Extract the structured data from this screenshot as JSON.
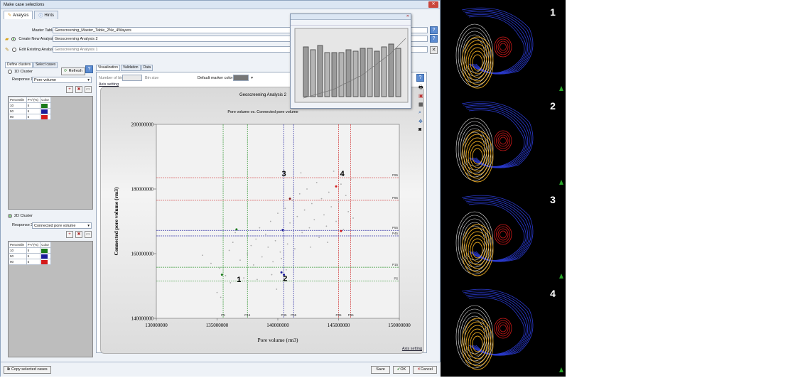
{
  "window": {
    "title": "Make case selections",
    "tabs": [
      {
        "label": "Analysis"
      },
      {
        "label": "Hints"
      }
    ]
  },
  "form": {
    "master_table_label": "Master Table:",
    "master_table_value": "Geoscreening_Master_Table_2Nx_4Wayers",
    "create_new_label": "Create New Analysis:",
    "create_new_value": "Geoscreening Analysis 2",
    "edit_existing_label": "Edit Existing Analysis:",
    "edit_existing_value": "Geoscreening Analysis 1"
  },
  "left_panel": {
    "tabs": [
      "Define clusters",
      "Select cases"
    ],
    "oned_label": "1D Cluster",
    "refresh_label": "Refresh",
    "response1_label": "Response 1:",
    "response1_value": "Pore volume",
    "twod_label": "2D Cluster",
    "response2_label": "Response 2:",
    "response2_value": "Connected pore volume",
    "table_headers": [
      "Percentile",
      "P+/-(%)",
      "Color"
    ],
    "rows1": [
      {
        "p": "10",
        "pm": "5",
        "color": "#1a7a1a"
      },
      {
        "p": "50",
        "pm": "5",
        "color": "#1a1a9a"
      },
      {
        "p": "90",
        "pm": "5",
        "color": "#d41a1a"
      }
    ],
    "rows2": [
      {
        "p": "10",
        "pm": "5",
        "color": "#1a7a1a"
      },
      {
        "p": "50",
        "pm": "5",
        "color": "#1a1a9a"
      },
      {
        "p": "90",
        "pm": "5",
        "color": "#d41a1a"
      }
    ]
  },
  "main_panel": {
    "tabs": [
      "Visualization",
      "Validation",
      "Data"
    ],
    "num_bins_label": "Number of bins",
    "bin_size_label": "Bin size",
    "marker_color_label": "Default marker color:",
    "axis_setting_top": "Axis setting",
    "axis_setting_bottom": "Axis setting"
  },
  "chart_data": {
    "type": "scatter",
    "title": "Geoscreening Analysis 2",
    "subtitle": "Pore volume vs. Connected pore volume",
    "xlabel": "Pore volume (rm3)",
    "ylabel": "Connected pore volume (rm3)",
    "xlim": [
      130000000,
      150000000
    ],
    "ylim": [
      140000000,
      200000000
    ],
    "xticks": [
      "130000000",
      "135000000",
      "140000000",
      "145000000",
      "150000000"
    ],
    "yticks": [
      "140000000",
      "160000000",
      "180000000",
      "200000000"
    ],
    "vlines": [
      {
        "x": 135500000,
        "label": "P5",
        "color": "#3a9a3a"
      },
      {
        "x": 137500000,
        "label": "P15",
        "color": "#3a9a3a"
      },
      {
        "x": 140500000,
        "label": "P45",
        "color": "#3a3aaa"
      },
      {
        "x": 141300000,
        "label": "P55",
        "color": "#3a3aaa"
      },
      {
        "x": 145000000,
        "label": "P85",
        "color": "#d43a3a"
      },
      {
        "x": 146000000,
        "label": "P95",
        "color": "#d43a3a"
      }
    ],
    "hlines": [
      {
        "y": 151500000,
        "label": "P5",
        "color": "#3a9a3a"
      },
      {
        "y": 155800000,
        "label": "P15",
        "color": "#3a9a3a"
      },
      {
        "y": 165500000,
        "label": "P45",
        "color": "#3a3aaa"
      },
      {
        "y": 167200000,
        "label": "P55",
        "color": "#3a3aaa"
      },
      {
        "y": 176500000,
        "label": "P85",
        "color": "#d43a3a"
      },
      {
        "y": 183500000,
        "label": "P95",
        "color": "#d43a3a"
      }
    ],
    "points": [
      [
        133800000,
        159500000
      ],
      [
        134500000,
        157000000
      ],
      [
        135000000,
        148000000
      ],
      [
        135200000,
        155500000
      ],
      [
        135700000,
        153200000
      ],
      [
        136000000,
        161000000
      ],
      [
        136300000,
        163500000
      ],
      [
        136500000,
        166500000
      ],
      [
        136900000,
        158000000
      ],
      [
        137200000,
        152500000
      ],
      [
        137500000,
        160000000
      ],
      [
        137800000,
        162500000
      ],
      [
        138000000,
        156500000
      ],
      [
        138200000,
        164500000
      ],
      [
        138500000,
        168000000
      ],
      [
        138700000,
        159000000
      ],
      [
        139000000,
        166000000
      ],
      [
        139200000,
        162000000
      ],
      [
        139400000,
        170000000
      ],
      [
        139600000,
        157500000
      ],
      [
        139800000,
        164000000
      ],
      [
        140000000,
        172500000
      ],
      [
        140200000,
        160500000
      ],
      [
        140400000,
        167000000
      ],
      [
        140600000,
        174000000
      ],
      [
        140800000,
        163000000
      ],
      [
        141000000,
        169500000
      ],
      [
        141200000,
        176500000
      ],
      [
        141400000,
        161500000
      ],
      [
        141600000,
        171500000
      ],
      [
        141800000,
        178500000
      ],
      [
        142000000,
        166500000
      ],
      [
        142200000,
        173500000
      ],
      [
        142400000,
        180000000
      ],
      [
        142600000,
        168000000
      ],
      [
        142800000,
        175500000
      ],
      [
        143000000,
        170500000
      ],
      [
        143200000,
        182000000
      ],
      [
        143400000,
        165000000
      ],
      [
        143600000,
        177000000
      ],
      [
        143800000,
        172000000
      ],
      [
        144000000,
        168500000
      ],
      [
        144200000,
        179000000
      ],
      [
        144400000,
        174500000
      ],
      [
        144600000,
        185500000
      ],
      [
        144800000,
        170000000
      ],
      [
        145000000,
        176000000
      ],
      [
        145200000,
        181500000
      ],
      [
        145400000,
        167500000
      ],
      [
        145600000,
        178000000
      ],
      [
        145800000,
        173000000
      ],
      [
        146000000,
        183000000
      ],
      [
        146200000,
        171000000
      ],
      [
        135300000,
        146500000
      ],
      [
        136100000,
        151000000
      ],
      [
        138300000,
        152000000
      ],
      [
        139500000,
        153500000
      ],
      [
        140700000,
        155000000
      ],
      [
        140300000,
        158500000
      ],
      [
        137000000,
        165500000
      ],
      [
        142700000,
        162000000
      ],
      [
        144100000,
        163500000
      ],
      [
        141900000,
        185000000
      ],
      [
        139900000,
        149000000
      ]
    ],
    "highlight_points": [
      {
        "x": 135400000,
        "y": 153500000,
        "color": "#1a7a1a"
      },
      {
        "x": 136600000,
        "y": 167500000,
        "color": "#1a7a1a"
      },
      {
        "x": 140300000,
        "y": 154200000,
        "color": "#1a1a9a"
      },
      {
        "x": 140500000,
        "y": 153500000,
        "color": "#1a1a9a"
      },
      {
        "x": 140400000,
        "y": 167300000,
        "color": "#1a1a9a"
      },
      {
        "x": 141000000,
        "y": 177000000,
        "color": "#8a1a1a"
      },
      {
        "x": 144800000,
        "y": 180800000,
        "color": "#d41a1a"
      },
      {
        "x": 145200000,
        "y": 167000000,
        "color": "#d41a1a"
      }
    ],
    "annotations": [
      {
        "text": "1",
        "x": 136800000,
        "y": 151200000
      },
      {
        "text": "2",
        "x": 140600000,
        "y": 151500000
      },
      {
        "text": "3",
        "x": 140500000,
        "y": 184000000
      },
      {
        "text": "4",
        "x": 145300000,
        "y": 184000000
      }
    ]
  },
  "bottom_bar": {
    "copy_label": "Copy selected cases",
    "save_label": "Save",
    "ok_label": "OK",
    "cancel_label": "Cancel"
  },
  "right_image": {
    "labels": [
      "1",
      "2",
      "3",
      "4"
    ]
  }
}
